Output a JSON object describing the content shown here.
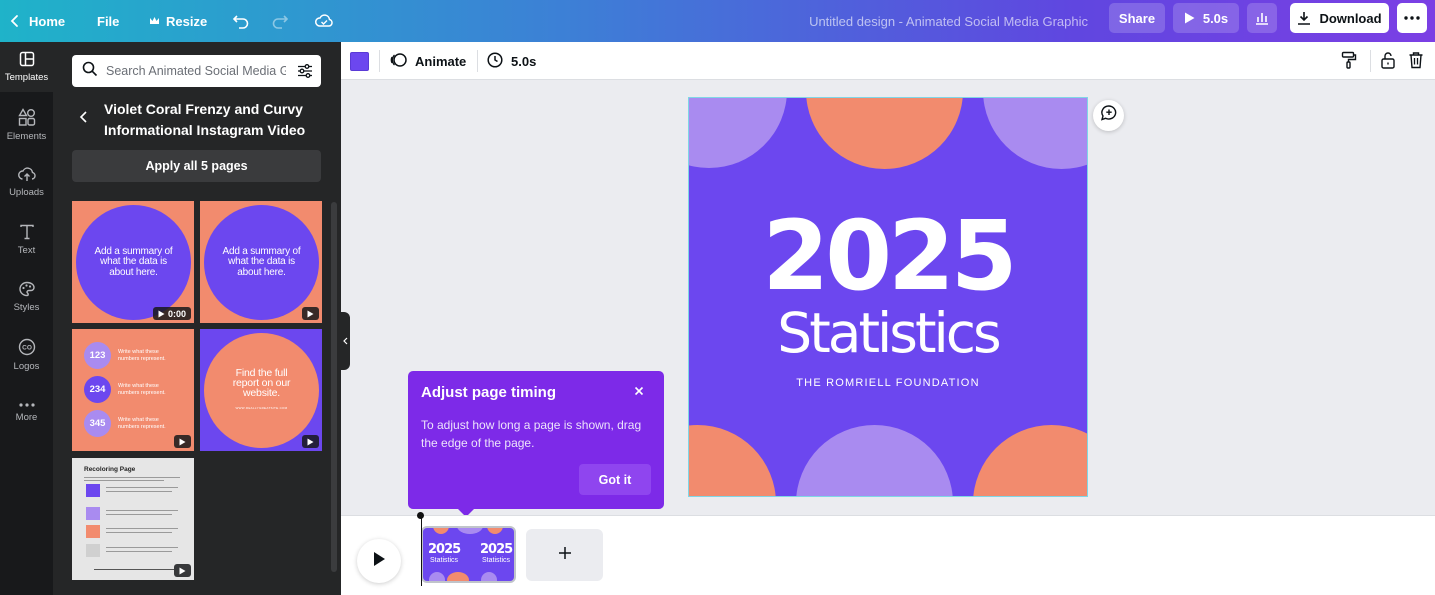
{
  "topbar": {
    "home_label": "Home",
    "file_label": "File",
    "resize_label": "Resize",
    "doc_title": "Untitled design - Animated Social Media Graphic",
    "share_label": "Share",
    "play_duration": "5.0s",
    "download_label": "Download",
    "icons": [
      "chevron-left-icon",
      "crown-icon",
      "undo-icon",
      "redo-icon",
      "cloud-sync-icon",
      "play-icon",
      "insights-icon",
      "download-icon",
      "more-icon"
    ]
  },
  "rail": {
    "items": [
      {
        "label": "Templates",
        "icon": "templates-icon",
        "active": true
      },
      {
        "label": "Elements",
        "icon": "elements-icon"
      },
      {
        "label": "Uploads",
        "icon": "uploads-icon"
      },
      {
        "label": "Text",
        "icon": "text-icon"
      },
      {
        "label": "Styles",
        "icon": "styles-icon"
      },
      {
        "label": "Logos",
        "icon": "logos-icon"
      },
      {
        "label": "More",
        "icon": "more-dots-icon"
      }
    ]
  },
  "panel": {
    "search_placeholder": "Search Animated Social Media Graphic templates",
    "template_title": "Violet Coral Frenzy and Curvy Informational Instagram Video",
    "apply_label": "Apply all 5 pages",
    "thumbs": [
      {
        "text": "Add a summary of what the data is about here.",
        "badge": "0:00"
      },
      {
        "text": "Add a summary of what the data is about here.",
        "badge": ""
      },
      {
        "numbers": [
          "123",
          "234",
          "345"
        ],
        "caption": "Write what these numbers represent.",
        "badge": ""
      },
      {
        "text": "Find the full report on our website.",
        "sub": "WWW.REALLYGREATSITE.COM",
        "badge": ""
      },
      {
        "title": "Recoloring Page",
        "badge": ""
      }
    ],
    "colors": {
      "coral": "#f28b6e",
      "violet": "#6c47ef",
      "lavender": "#a98bf0"
    }
  },
  "context": {
    "color": "#6c47ef",
    "animate_label": "Animate",
    "timing_label": "5.0s"
  },
  "design": {
    "year": "2025",
    "heading": "Statistics",
    "organization": "THE ROMRIELL FOUNDATION",
    "colors": {
      "background": "#6c47ef",
      "coral": "#f28b6e",
      "lavender": "#a98bf0"
    }
  },
  "tooltip": {
    "title": "Adjust page timing",
    "body": "To adjust how long a page is shown, drag the edge of the page.",
    "button": "Got it"
  },
  "timeline": {
    "thumb_year": "2025",
    "thumb_heading": "Statistics"
  }
}
